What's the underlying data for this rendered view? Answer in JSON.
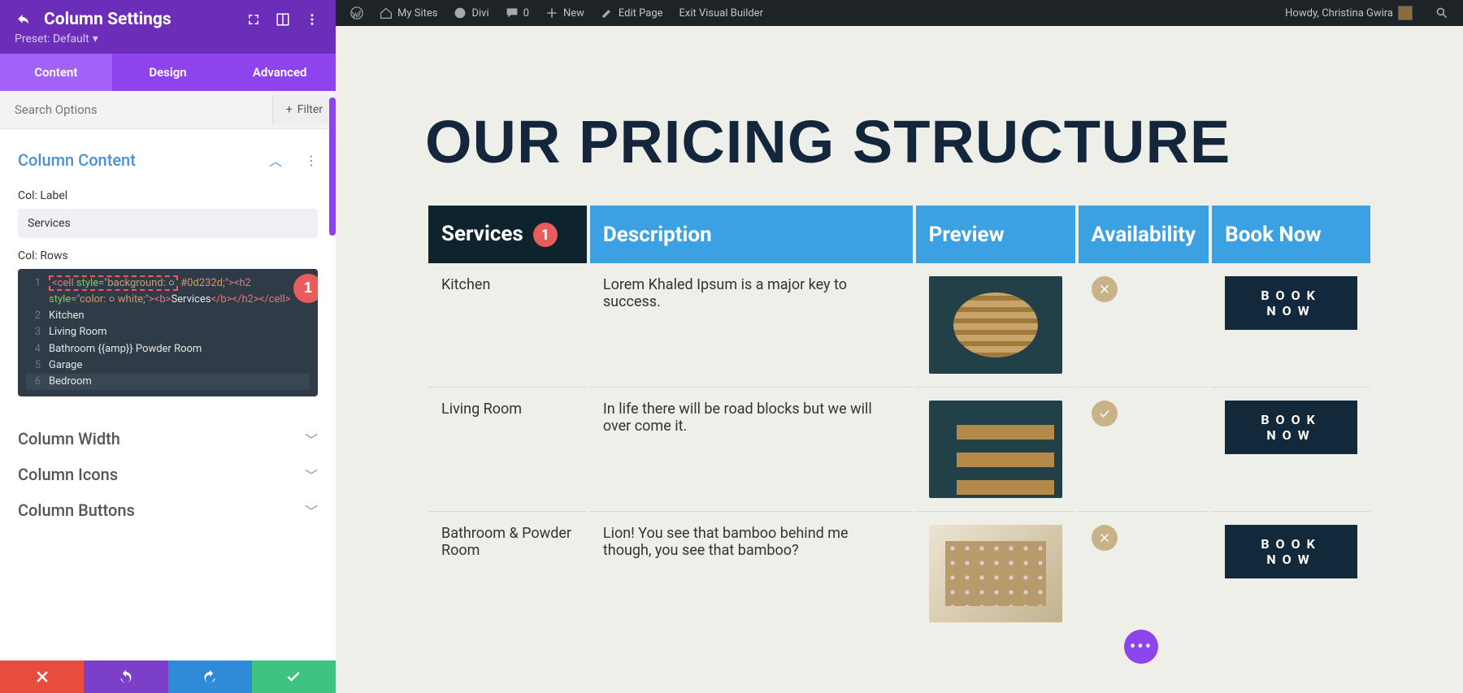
{
  "admin_bar": {
    "my_sites": "My Sites",
    "divi": "Divi",
    "comments": "0",
    "new": "New",
    "edit_page": "Edit Page",
    "exit_builder": "Exit Visual Builder",
    "howdy": "Howdy, Christina Gwira"
  },
  "panel": {
    "title": "Column Settings",
    "preset": "Preset: Default",
    "tabs": {
      "content": "Content",
      "design": "Design",
      "advanced": "Advanced"
    },
    "search_placeholder": "Search Options",
    "filter": "Filter",
    "sections": {
      "column_content": "Column Content",
      "column_width": "Column Width",
      "column_icons": "Column Icons",
      "column_buttons": "Column Buttons"
    },
    "col_label": "Col: Label",
    "col_label_value": "Services",
    "col_rows": "Col: Rows",
    "code_lines": [
      "<cell style=\"background: ○ #0d232d;\"><h2 style=\"color: ○ white;\"><b>Services</b></h2></cell>",
      "Kitchen",
      "Living Room",
      "Bathroom {{amp}} Powder Room",
      "Garage",
      "Bedroom"
    ],
    "badge_1": "1"
  },
  "preview": {
    "heading": "OUR PRICING STRUCTURE",
    "columns": [
      "Services",
      "Description",
      "Preview",
      "Availability",
      "Book Now"
    ],
    "header_badge": "1",
    "rows": [
      {
        "service": "Kitchen",
        "desc": "Lorem Khaled Ipsum is a major key to success.",
        "available": false,
        "book": "BOOK NOW"
      },
      {
        "service": "Living Room",
        "desc": "In life there will be road blocks but we will over come it.",
        "available": true,
        "book": "BOOK NOW"
      },
      {
        "service": "Bathroom & Powder Room",
        "desc": "Lion! You see that bamboo behind me though, you see that bamboo?",
        "available": false,
        "book": "BOOK NOW"
      }
    ]
  }
}
